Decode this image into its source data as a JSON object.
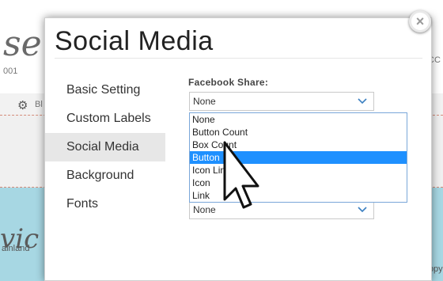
{
  "background": {
    "script_heading": "se",
    "small_left": "001",
    "small_right": "CC",
    "bar_text": "Bl",
    "script_heading_2": "vic",
    "footer_left": "ainland",
    "footer_right": "Copy"
  },
  "modal": {
    "title": "Social Media",
    "close_symbol": "×",
    "nav": [
      {
        "label": "Basic Setting"
      },
      {
        "label": "Custom Labels"
      },
      {
        "label": "Social Media"
      },
      {
        "label": "Background"
      },
      {
        "label": "Fonts"
      }
    ],
    "active_nav": "Social Media",
    "facebook_share": {
      "label": "Facebook Share:",
      "value": "None",
      "options": [
        "None",
        "Button Count",
        "Box Count",
        "Button",
        "Icon Link",
        "Icon",
        "Link"
      ],
      "highlighted": "Button"
    },
    "second_select": {
      "value": "None"
    }
  },
  "colors": {
    "accent": "#1e90ff",
    "chevron": "#3a7fc1",
    "blue_band": "#a7d7e3",
    "dash_line": "#d48c7a"
  },
  "icons": [
    "gear-icon",
    "close-icon",
    "chevron-down-icon",
    "mouse-pointer-icon"
  ]
}
